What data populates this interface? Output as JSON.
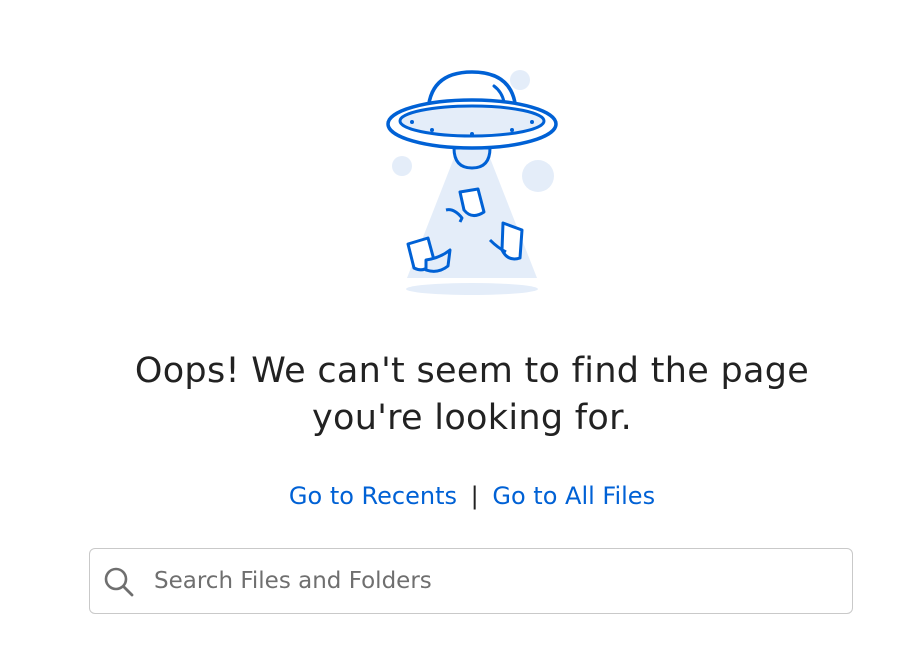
{
  "error": {
    "illustration": "ufo-abducting-files-icon",
    "message_line1": "Oops! We can't seem to find the page",
    "message_line2": "you're looking for."
  },
  "links": {
    "recents_label": "Go to Recents",
    "separator": "|",
    "all_files_label": "Go to All Files"
  },
  "search": {
    "placeholder": "Search Files and Folders",
    "value": "",
    "icon": "search-icon"
  },
  "colors": {
    "brand_blue": "#0061d5",
    "light_blue": "#e4edf9",
    "text": "#222222",
    "placeholder": "#6f6f6f",
    "border": "#c9c9c9"
  }
}
